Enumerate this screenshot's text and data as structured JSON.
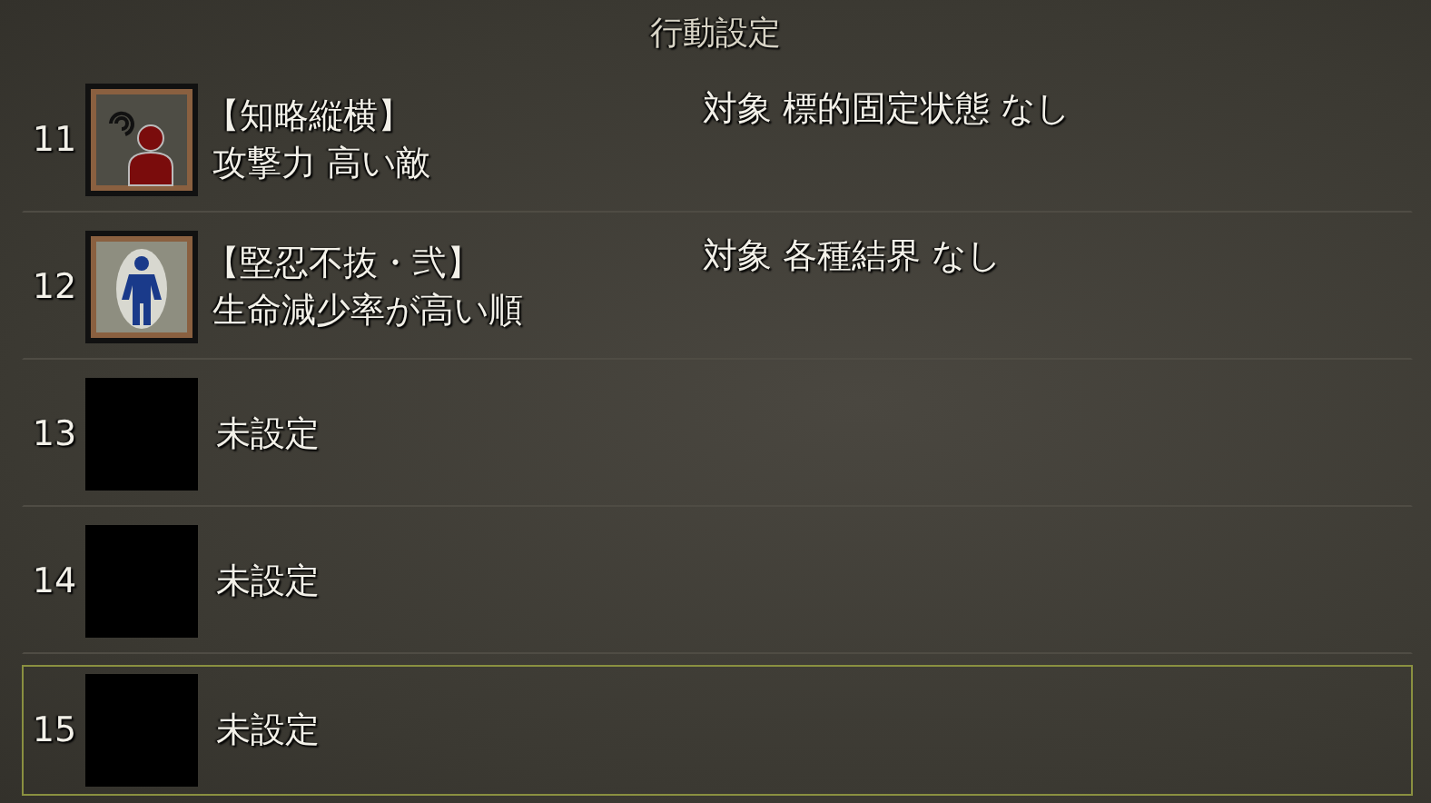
{
  "window": {
    "title": "行動設定"
  },
  "rows": [
    {
      "kind": "enemy",
      "number": "11",
      "skill": "【知略縦横】",
      "condition": "攻撃力 高い敵",
      "target": "対象 標的固定状態 なし",
      "selected": false
    },
    {
      "kind": "self",
      "number": "12",
      "skill": "【堅忍不抜・弐】",
      "condition": "生命減少率が高い順",
      "target": "対象 各種結界 なし",
      "selected": false
    },
    {
      "kind": "empty",
      "number": "13",
      "label": "未設定",
      "selected": false
    },
    {
      "kind": "empty",
      "number": "14",
      "label": "未設定",
      "selected": false
    },
    {
      "kind": "empty",
      "number": "15",
      "label": "未設定",
      "selected": true
    }
  ]
}
